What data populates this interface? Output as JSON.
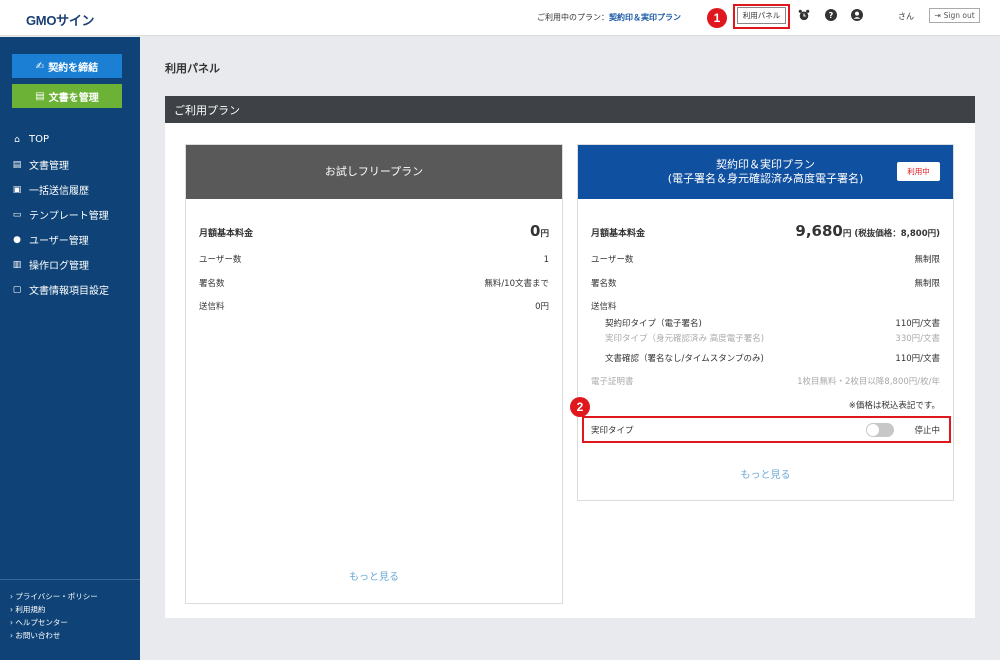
{
  "header": {
    "logo": "GMOサイン",
    "plan_label": "ご利用中のプラン：",
    "plan_name": "契約印＆実印プラン",
    "panel_button": "利用パネル",
    "user_name": "さん",
    "signout": "Sign out",
    "help_icon": "?"
  },
  "badges": {
    "one": "1",
    "two": "2"
  },
  "sidebar": {
    "sign_button": "契約を締結",
    "manage_button": "文書を管理",
    "items": [
      {
        "label": "TOP",
        "icon": "home-icon"
      },
      {
        "label": "文書管理",
        "icon": "document-icon"
      },
      {
        "label": "一括送信履歴",
        "icon": "batch-send-icon"
      },
      {
        "label": "テンプレート管理",
        "icon": "template-icon"
      },
      {
        "label": "ユーザー管理",
        "icon": "user-icon"
      },
      {
        "label": "操作ログ管理",
        "icon": "log-icon"
      },
      {
        "label": "文書情報項目設定",
        "icon": "field-settings-icon"
      }
    ],
    "footer": [
      "› プライバシー・ポリシー",
      "› 利用規約",
      "› ヘルプセンター",
      "› お問い合わせ"
    ]
  },
  "main": {
    "page_title": "利用パネル",
    "panel_title": "ご利用プラン"
  },
  "free_plan": {
    "title": "お試しフリープラン",
    "fee_label": "月額基本料金",
    "fee_value": "0",
    "fee_unit": "円",
    "users_label": "ユーザー数",
    "users_value": "1",
    "signs_label": "署名数",
    "signs_value": "無料/10文書まで",
    "send_label": "送信料",
    "send_value": "0円",
    "more": "もっと見る"
  },
  "paid_plan": {
    "title_line1": "契約印＆実印プラン",
    "title_line2": "(電子署名＆身元確認済み高度電子署名)",
    "in_use": "利用中",
    "fee_label": "月額基本料金",
    "fee_value": "9,680",
    "fee_unit": "円 (税抜価格：8,800円)",
    "users_label": "ユーザー数",
    "users_value": "無制限",
    "signs_label": "署名数",
    "signs_value": "無制限",
    "send_label": "送信料",
    "send_items": [
      {
        "label": "契約印タイプ（電子署名)",
        "value": "110円/文書"
      },
      {
        "label": "実印タイプ（身元確認済み 高度電子署名)",
        "value": "330円/文書"
      },
      {
        "label": "文書確認（署名なし/タイムスタンプのみ)",
        "value": "110円/文書"
      }
    ],
    "cert_label": "電子証明書",
    "cert_value": "1枚目無料・2枚目以降8,800円/枚/年",
    "tax_note": "※価格は税込表記です。",
    "jitsuin_label": "実印タイプ",
    "jitsuin_status": "停止中",
    "jitsuin_enabled": false,
    "more": "もっと見る"
  }
}
